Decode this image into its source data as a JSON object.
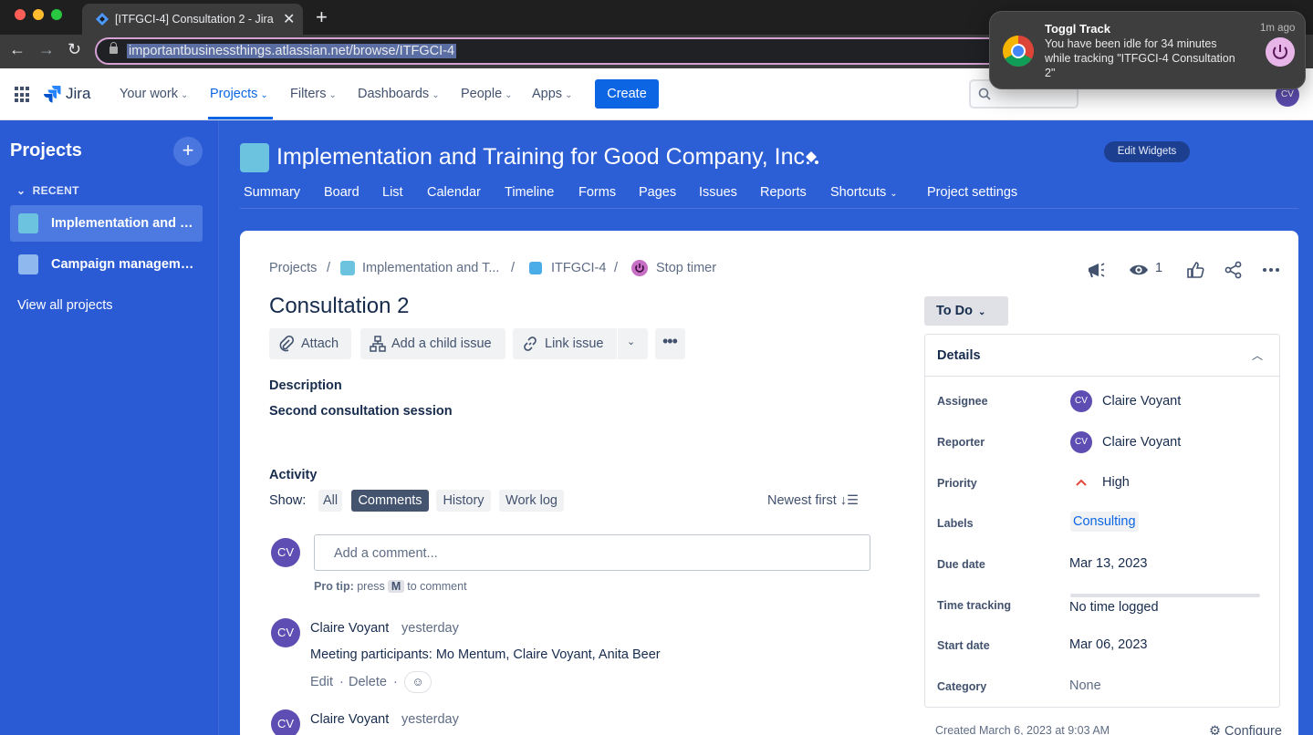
{
  "browser": {
    "tab_title": "[ITFGCI-4] Consultation 2 - Jira",
    "tab_close": "✕",
    "new_tab": "+",
    "url": "importantbusinessthings.atlassian.net/browse/ITFGCI-4"
  },
  "topnav": {
    "brand": "Jira",
    "items": [
      {
        "label": "Your work"
      },
      {
        "label": "Projects"
      },
      {
        "label": "Filters"
      },
      {
        "label": "Dashboards"
      },
      {
        "label": "People"
      },
      {
        "label": "Apps"
      }
    ],
    "create_label": "Create",
    "avatar_initials": "CV"
  },
  "sidebar": {
    "title": "Projects",
    "add_label": "+",
    "recent_label": "RECENT",
    "items": [
      {
        "label": "Implementation and Training for Good Company, Inc."
      },
      {
        "label": "Campaign management"
      }
    ],
    "view_all": "View all projects"
  },
  "project": {
    "title": "Implementation and Training for Good Company, Inc.",
    "edit_widgets": "Edit Widgets",
    "tabs": [
      {
        "label": "Summary"
      },
      {
        "label": "Board"
      },
      {
        "label": "List"
      },
      {
        "label": "Calendar"
      },
      {
        "label": "Timeline"
      },
      {
        "label": "Forms"
      },
      {
        "label": "Pages"
      },
      {
        "label": "Issues"
      },
      {
        "label": "Reports"
      },
      {
        "label": "Shortcuts"
      },
      {
        "label": "Project settings"
      }
    ]
  },
  "breadcrumb": {
    "projects": "Projects",
    "project": "Implementation and T...",
    "issue_key": "ITFGCI-4",
    "timer": "Stop timer",
    "sep": "/"
  },
  "issue": {
    "title": "Consultation 2",
    "actions": {
      "attach": "Attach",
      "add_child": "Add a child issue",
      "link": "Link issue"
    },
    "description_heading": "Description",
    "description": "Second consultation session",
    "watch_count": "1"
  },
  "activity": {
    "heading": "Activity",
    "show_label": "Show:",
    "filters": [
      "All",
      "Comments",
      "History",
      "Work log"
    ],
    "selected_filter": "Comments",
    "sort_label": "Newest first",
    "comment_placeholder": "Add a comment...",
    "protip_prefix": "Pro tip:",
    "protip_press": "press",
    "protip_key": "M",
    "protip_suffix": "to comment",
    "comments": [
      {
        "author": "Claire Voyant",
        "initials": "CV",
        "time": "yesterday",
        "body": "Meeting participants: Mo Mentum, Claire Voyant, Anita Beer",
        "edit": "Edit",
        "delete": "Delete",
        "dot": "·"
      },
      {
        "author": "Claire Voyant",
        "initials": "CV",
        "time": "yesterday"
      }
    ],
    "current_user_initials": "CV"
  },
  "status": {
    "label": "To Do"
  },
  "details": {
    "heading": "Details",
    "fields": {
      "assignee_label": "Assignee",
      "assignee": "Claire Voyant",
      "reporter_label": "Reporter",
      "reporter": "Claire Voyant",
      "priority_label": "Priority",
      "priority": "High",
      "labels_label": "Labels",
      "labels": "Consulting",
      "due_label": "Due date",
      "due": "Mar 13, 2023",
      "time_label": "Time tracking",
      "time": "No time logged",
      "start_label": "Start date",
      "start": "Mar 06, 2023",
      "category_label": "Category",
      "category": "None",
      "initials": "CV"
    },
    "created": "Created March 6, 2023 at 9:03 AM",
    "configure": "Configure"
  },
  "notification": {
    "app": "Toggl Track",
    "when": "1m ago",
    "message": "You have been idle for 34 minutes while tracking \"ITFGCI-4 Consultation 2\""
  },
  "colors": {
    "jira_blue": "#0c66e4",
    "project_bg": "#2c5ed6",
    "avatar": "#5e4db2",
    "priority_high": "#e2483d"
  }
}
